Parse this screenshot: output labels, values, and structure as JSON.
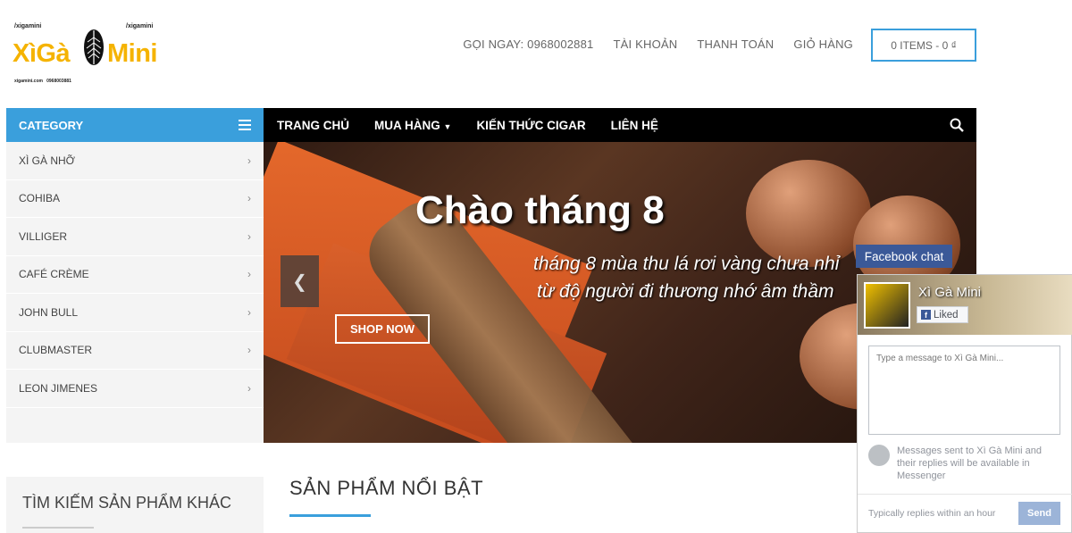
{
  "logo": {
    "twitter": "/xigamini",
    "facebook": "/xigamini",
    "brand_left": "XìGà",
    "brand_right": "Mini",
    "website": "xigamini.com",
    "phone": "0968003881"
  },
  "topnav": {
    "call": "GỌI NGAY: 0968002881",
    "account": "TÀI KHOẢN",
    "checkout": "THANH TOÁN",
    "cart": "GIỎ HÀNG"
  },
  "cart_button": "0 ITEMS - 0 ₫",
  "category": {
    "title": "CATEGORY",
    "items": [
      {
        "label": "XÌ GÀ NHỠ"
      },
      {
        "label": "COHIBA"
      },
      {
        "label": "VILLIGER"
      },
      {
        "label": "CAFÉ CRÈME"
      },
      {
        "label": "JOHN BULL"
      },
      {
        "label": "CLUBMASTER"
      },
      {
        "label": "LEON JIMENES"
      }
    ]
  },
  "mainnav": {
    "home": "TRANG CHỦ",
    "shop": "MUA HÀNG",
    "knowledge": "KIẾN THỨC CIGAR",
    "contact": "LIÊN HỆ"
  },
  "banner": {
    "title": "Chào tháng 8",
    "line1": "tháng 8 mùa thu lá rơi vàng chưa nhỉ",
    "line2": "từ độ người đi thương nhớ âm thầm",
    "button": "SHOP NOW"
  },
  "search_section": {
    "title": "TÌM KIẾM SẢN PHẨM KHÁC"
  },
  "featured": {
    "title": "SẢN PHẨM NỔI BẬT"
  },
  "facebook_chat": {
    "tab_label": "Facebook chat",
    "page_name": "Xì Gà Mini",
    "liked": "Liked",
    "message_placeholder": "Type a message to Xì Gà Mini...",
    "info": "Messages sent to Xì Gà Mini and their replies will be available in Messenger",
    "reply_time": "Typically replies within an hour",
    "send": "Send"
  },
  "colors": {
    "accent": "#3a9fdc",
    "logo": "#f5b300",
    "facebook": "#3b5998"
  }
}
